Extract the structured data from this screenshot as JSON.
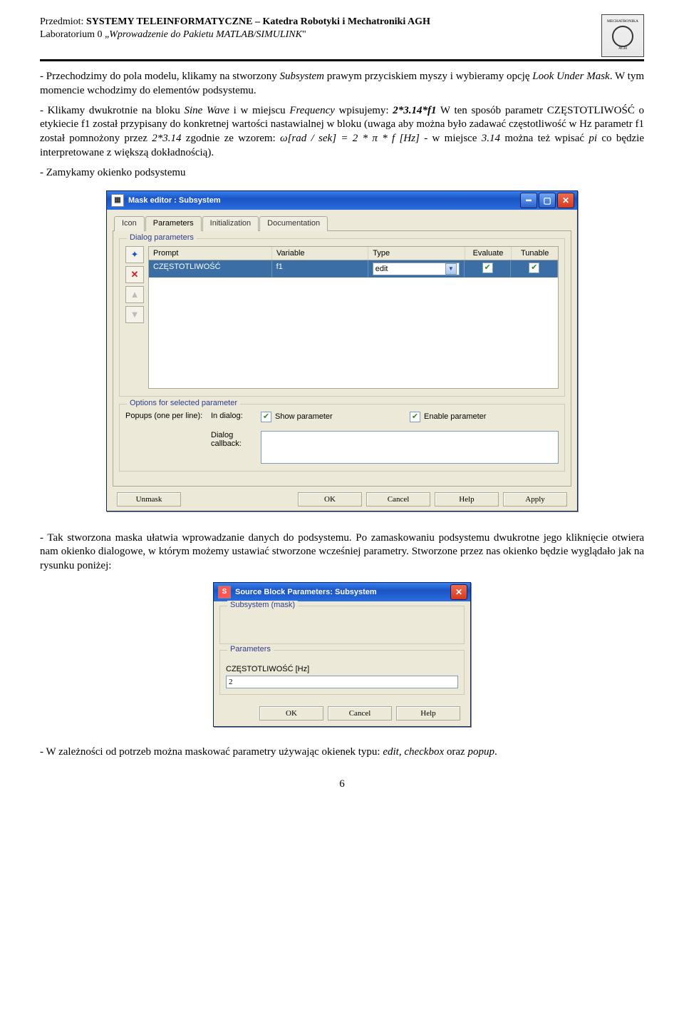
{
  "header": {
    "line1_prefix": "Przedmiot: ",
    "line1_bold": "SYSTEMY TELEINFORMATYCZNE – Katedra Robotyki i Mechatroniki AGH",
    "line2_prefix": "Laboratorium 0 „",
    "line2_ital": "Wprowadzenie do Pakietu MATLAB/SIMULINK",
    "line2_suffix": "\"",
    "logo_top": "MECHATRONIKA",
    "logo_bottom": "AGH"
  },
  "para1_a": "- Przechodzimy do pola modelu, klikamy na stworzony ",
  "para1_b": "Subsystem",
  "para1_c": " prawym przyciskiem myszy i wybieramy opcję ",
  "para1_d": "Look Under Mask",
  "para1_e": ". W tym momencie wchodzimy do elementów podsystemu.",
  "para2_a": "- Klikamy dwukrotnie na bloku ",
  "para2_b": "Sine Wave",
  "para2_c": " i w miejscu ",
  "para2_d": "Frequency",
  "para2_e": " wpisujemy: ",
  "para2_f": "2*3.14*f1",
  "para2_g": " W ten sposób parametr CZĘSTOTLIWOŚĆ o etykiecie f1 został przypisany do konkretnej wartości nastawialnej w bloku (uwaga aby można było zadawać częstotliwość w Hz parametr f1 został pomnożony przez ",
  "para2_h": "2*3.14",
  "para2_i": " zgodnie ze wzorem: ",
  "para2_formula": "ω[rad / sek] = 2 * π * f [Hz]",
  "para2_j": " - w miejsce ",
  "para2_k": "3.14",
  "para2_l": " można też wpisać ",
  "para2_m": "pi",
  "para2_n": " co będzie interpretowane z większą dokładnością).",
  "para3": "- Zamykamy okienko podsystemu",
  "maskEditor": {
    "title": "Mask editor : Subsystem",
    "tabs": [
      "Icon",
      "Parameters",
      "Initialization",
      "Documentation"
    ],
    "activeTab": 1,
    "dialogParamsLegend": "Dialog parameters",
    "headers": {
      "prompt": "Prompt",
      "variable": "Variable",
      "type": "Type",
      "evaluate": "Evaluate",
      "tunable": "Tunable"
    },
    "row": {
      "prompt": "CZĘSTOTLIWOŚĆ",
      "variable": "f1",
      "type": "edit",
      "evaluate": true,
      "tunable": true
    },
    "optionsLegend": "Options for selected parameter",
    "popupsLabel": "Popups (one per line):",
    "inDialogLabel": "In dialog:",
    "showParam": "Show parameter",
    "enableParam": "Enable parameter",
    "dialogCallback": "Dialog callback:",
    "buttons": {
      "unmask": "Unmask",
      "ok": "OK",
      "cancel": "Cancel",
      "help": "Help",
      "apply": "Apply"
    }
  },
  "para4": "- Tak stworzona maska ułatwia wprowadzanie danych do podsystemu. Po zamaskowaniu podsystemu dwukrotne jego kliknięcie otwiera nam okienko dialogowe, w którym możemy ustawiać stworzone wcześniej parametry. Stworzone przez nas okienko będzie wyglądało jak na rysunku poniżej:",
  "sbp": {
    "title": "Source Block Parameters: Subsystem",
    "legend1": "Subsystem (mask)",
    "legend2": "Parameters",
    "paramLabel": "CZĘSTOTLIWOŚĆ [Hz]",
    "paramValue": "2",
    "buttons": {
      "ok": "OK",
      "cancel": "Cancel",
      "help": "Help"
    }
  },
  "para5_a": "- W zależności od potrzeb można maskować parametry używając okienek typu: ",
  "para5_b": "edit, checkbox",
  "para5_c": " oraz ",
  "para5_d": "popup",
  "para5_e": ".",
  "pageNumber": "6"
}
